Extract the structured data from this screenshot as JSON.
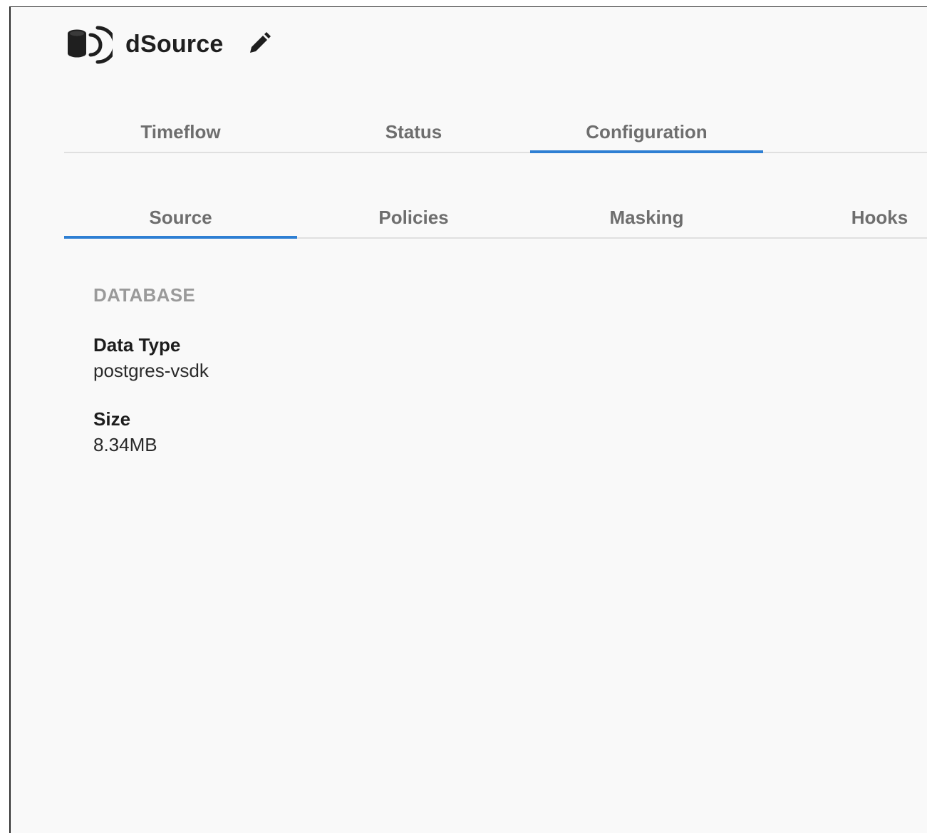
{
  "header": {
    "title": "dSource",
    "icon": "database-broadcast-icon",
    "edit_icon": "pencil-icon"
  },
  "primary_tabs": [
    {
      "label": "Timeflow",
      "active": false
    },
    {
      "label": "Status",
      "active": false
    },
    {
      "label": "Configuration",
      "active": true
    }
  ],
  "secondary_tabs": [
    {
      "label": "Source",
      "active": true
    },
    {
      "label": "Policies",
      "active": false
    },
    {
      "label": "Masking",
      "active": false
    },
    {
      "label": "Hooks",
      "active": false
    }
  ],
  "database": {
    "section_title": "DATABASE",
    "fields": [
      {
        "label": "Data Type",
        "value": "postgres-vsdk"
      },
      {
        "label": "Size",
        "value": "8.34MB"
      }
    ]
  },
  "colors": {
    "accent": "#2e7fd3",
    "tab_text": "#6e6e6e",
    "section_title": "#9a9a9a",
    "background": "#f9f9f9"
  }
}
